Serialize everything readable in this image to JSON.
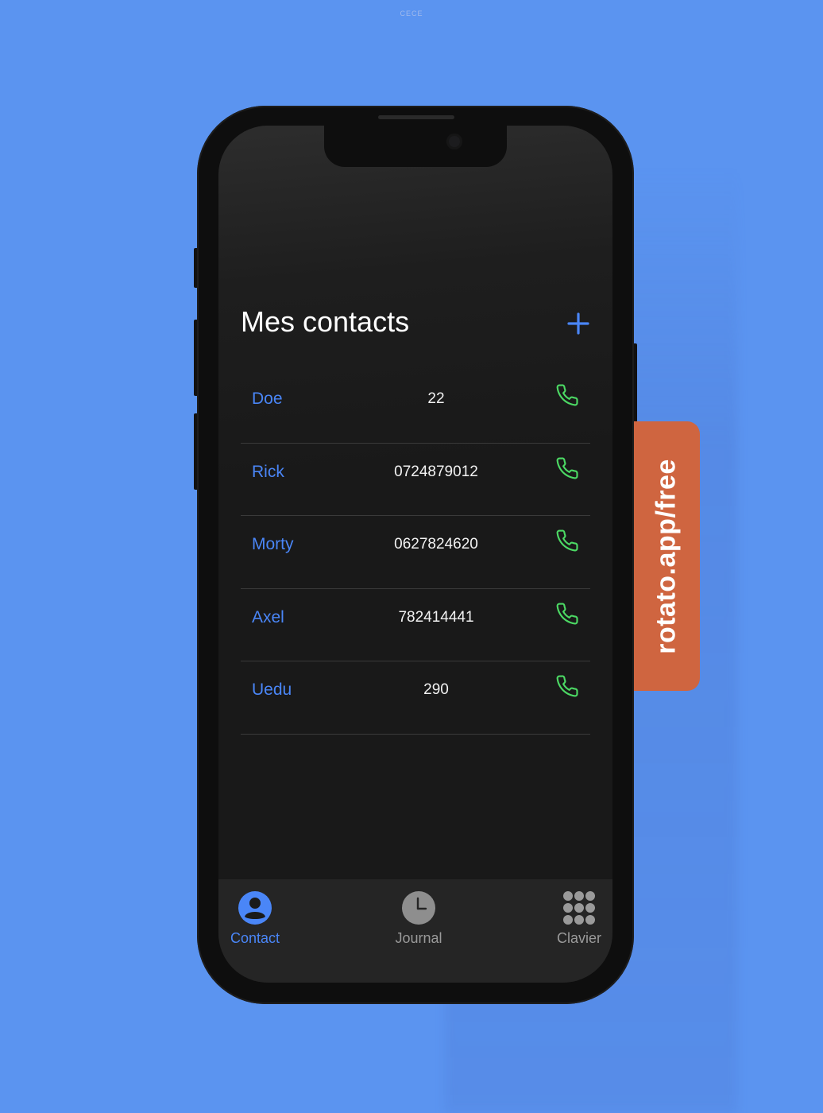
{
  "watermark": "CECE",
  "app": {
    "title": "Mes contacts",
    "add_icon": "plus-icon",
    "accent_color": "#4a86f7",
    "call_color": "#4cd964"
  },
  "contacts": [
    {
      "name": "Doe",
      "number": "22"
    },
    {
      "name": "Rick",
      "number": "0724879012"
    },
    {
      "name": "Morty",
      "number": "0627824620"
    },
    {
      "name": "Axel",
      "number": "782414441"
    },
    {
      "name": "Uedu",
      "number": "290"
    }
  ],
  "tabbar": {
    "tabs": [
      {
        "label": "Contact",
        "icon": "person-icon",
        "active": true
      },
      {
        "label": "Journal",
        "icon": "clock-icon",
        "active": false
      },
      {
        "label": "Clavier",
        "icon": "keypad-icon",
        "active": false
      }
    ]
  },
  "promo": {
    "text": "rotato.app/free",
    "color": "#cf6540"
  }
}
